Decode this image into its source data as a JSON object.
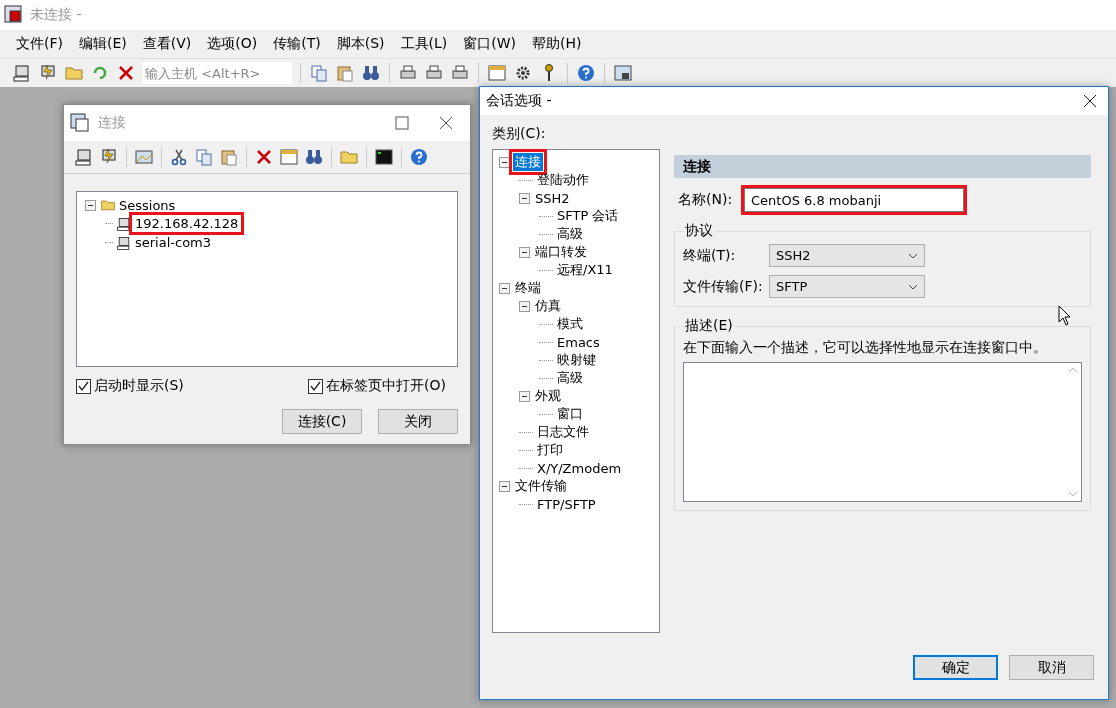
{
  "app": {
    "title": "未连接 -",
    "menu": [
      "文件(F)",
      "编辑(E)",
      "查看(V)",
      "选项(O)",
      "传输(T)",
      "脚本(S)",
      "工具(L)",
      "窗口(W)",
      "帮助(H)"
    ],
    "host_field": {
      "placeholder": "输入主机 <Alt+R>"
    }
  },
  "connect_dialog": {
    "title": "连接",
    "sessions": {
      "label": "Sessions",
      "expanded": true,
      "children": [
        {
          "label": "192.168.42.128",
          "highlighted": true
        },
        {
          "label": "serial-com3",
          "highlighted": false
        }
      ]
    },
    "options": [
      {
        "label": "启动时显示(S)",
        "checked": true
      },
      {
        "label": "在标签页中打开(O)",
        "checked": true
      }
    ],
    "buttons": [
      "连接(C)",
      "关闭"
    ]
  },
  "session_dialog": {
    "title": "会话选项 -",
    "category_label": "类别(C):",
    "categories": [
      {
        "label": "连接",
        "selected": true,
        "highlighted": true,
        "expanded": true,
        "children": [
          {
            "label": "登陆动作",
            "selected": false,
            "highlighted": false
          },
          {
            "label": "SSH2",
            "selected": false,
            "highlighted": false,
            "expanded": true,
            "children": [
              {
                "label": "SFTP 会话",
                "selected": false,
                "highlighted": false
              },
              {
                "label": "高级",
                "selected": false,
                "highlighted": false
              }
            ]
          },
          {
            "label": "端口转发",
            "selected": false,
            "highlighted": false,
            "expanded": true,
            "children": [
              {
                "label": "远程/X11",
                "selected": false,
                "highlighted": false
              }
            ]
          }
        ]
      },
      {
        "label": "终端",
        "selected": false,
        "highlighted": false,
        "expanded": true,
        "children": [
          {
            "label": "仿真",
            "selected": false,
            "highlighted": false,
            "expanded": true,
            "children": [
              {
                "label": "模式",
                "selected": false,
                "highlighted": false
              },
              {
                "label": "Emacs",
                "selected": false,
                "highlighted": false
              },
              {
                "label": "映射键",
                "selected": false,
                "highlighted": false
              },
              {
                "label": "高级",
                "selected": false,
                "highlighted": false
              }
            ]
          },
          {
            "label": "外观",
            "selected": false,
            "highlighted": false,
            "expanded": true,
            "children": [
              {
                "label": "窗口",
                "selected": false,
                "highlighted": false
              }
            ]
          },
          {
            "label": "日志文件",
            "selected": false,
            "highlighted": false
          },
          {
            "label": "打印",
            "selected": false,
            "highlighted": false
          },
          {
            "label": "X/Y/Zmodem",
            "selected": false,
            "highlighted": false
          }
        ]
      },
      {
        "label": "文件传输",
        "selected": false,
        "highlighted": false,
        "expanded": true,
        "children": [
          {
            "label": "FTP/SFTP",
            "selected": false,
            "highlighted": false
          }
        ]
      }
    ],
    "section_title": "连接",
    "name": {
      "label": "名称(N):",
      "value": "CentOS 6.8 mobanji",
      "highlighted": true
    },
    "protocol": {
      "title": "协议",
      "fields": [
        {
          "label": "终端(T):",
          "value": "SSH2"
        },
        {
          "label": "文件传输(F):",
          "value": "SFTP"
        }
      ]
    },
    "description": {
      "title": "描述(E)",
      "text": "在下面输入一个描述，它可以选择性地显示在连接窗口中。"
    },
    "buttons": [
      {
        "label": "确定",
        "default": true
      },
      {
        "label": "取消",
        "default": false
      }
    ]
  }
}
